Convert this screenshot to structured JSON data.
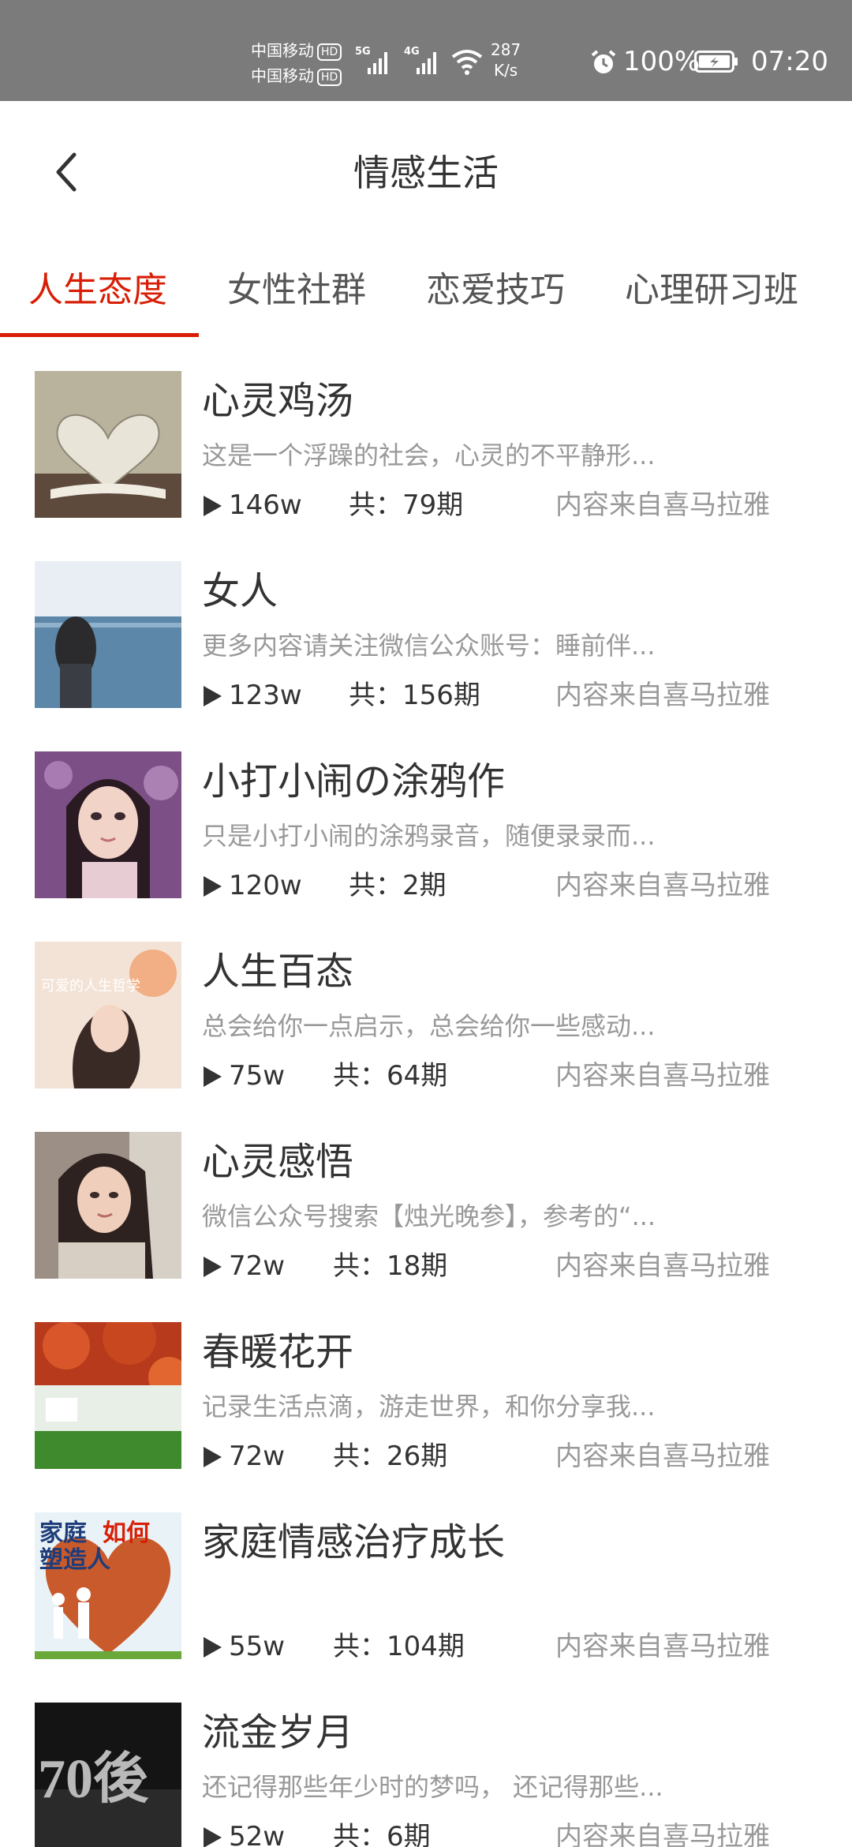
{
  "status_bar": {
    "carrier_1": "中国移动",
    "carrier_2": "中国移动",
    "hd": "HD",
    "sig1": "5G",
    "sig2": "4G",
    "speed_value": "287",
    "speed_unit": "K/s",
    "battery": "100%",
    "time": "07:20",
    "icons": [
      "signal-icon",
      "wifi-icon",
      "alarm-icon",
      "battery-charging-icon"
    ]
  },
  "header": {
    "title": "情感生活",
    "back_icon": "chevron-left-icon"
  },
  "tabs": [
    {
      "label": "人生态度",
      "active": true
    },
    {
      "label": "女性社群",
      "active": false
    },
    {
      "label": "恋爱技巧",
      "active": false
    },
    {
      "label": "心理研习班",
      "active": false
    }
  ],
  "accent_color": "#d81e06",
  "items": [
    {
      "title": "心灵鸡汤",
      "desc": "这是一个浮躁的社会，心灵的不平静形...",
      "plays": "146w",
      "episodes": "共：79期",
      "source": "内容来自喜马拉雅"
    },
    {
      "title": "女人",
      "desc": "更多内容请关注微信公众账号：睡前伴...",
      "plays": "123w",
      "episodes": "共：156期",
      "source": "内容来自喜马拉雅"
    },
    {
      "title": "小打小闹の涂鸦作",
      "desc": "只是小打小闹的涂鸦录音，随便录录而...",
      "plays": "120w",
      "episodes": "共：2期",
      "source": "内容来自喜马拉雅"
    },
    {
      "title": "人生百态",
      "desc": "总会给你一点启示，总会给你一些感动...",
      "plays": "75w",
      "episodes": "共：64期",
      "source": "内容来自喜马拉雅",
      "thumb_text": "可爱的人生哲学"
    },
    {
      "title": "心灵感悟",
      "desc": "微信公众号搜索【烛光晚参】，参考的“...",
      "plays": "72w",
      "episodes": "共：18期",
      "source": "内容来自喜马拉雅"
    },
    {
      "title": "春暖花开",
      "desc": "记录生活点滴，游走世界，和你分享我...",
      "plays": "72w",
      "episodes": "共：26期",
      "source": "内容来自喜马拉雅"
    },
    {
      "title": "家庭情感治疗成长",
      "desc": "",
      "plays": "55w",
      "episodes": "共：104期",
      "source": "内容来自喜马拉雅",
      "thumb_text_a": "家庭",
      "thumb_text_b": "如何",
      "thumb_text_c": "塑造人"
    },
    {
      "title": "流金岁月",
      "desc": "还记得那些年少时的梦吗， 还记得那些...",
      "plays": "52w",
      "episodes": "共：6期",
      "source": "内容来自喜马拉雅",
      "thumb_text": "70後"
    }
  ]
}
